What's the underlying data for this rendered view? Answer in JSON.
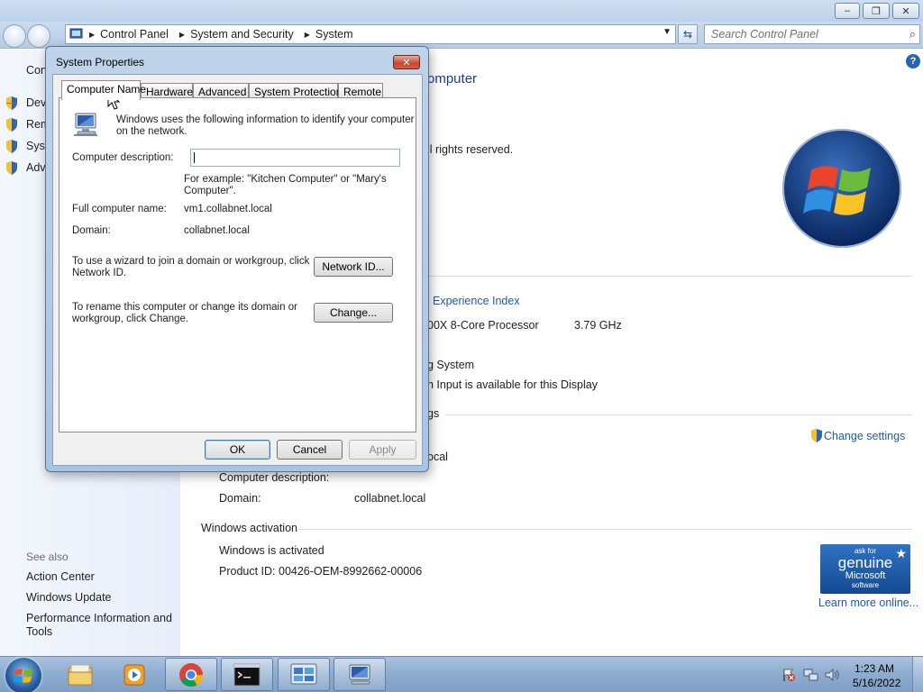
{
  "explorer": {
    "address": [
      "Control Panel",
      "System and Security",
      "System"
    ],
    "search_placeholder": "Search Control Panel"
  },
  "left_pane": {
    "home_label": "Con",
    "items": [
      "Devi",
      "Rem",
      "Syst",
      "Adv"
    ],
    "see_also_label": "See also",
    "see_also": [
      "Action Center",
      "Windows Update",
      "Performance Information and",
      "Tools"
    ]
  },
  "main": {
    "header": "omputer",
    "copyright": "ll rights reserved.",
    "experience_index_link": "Experience Index",
    "processor": "00X 8-Core Processor",
    "processor_speed": "3.79 GHz",
    "system_type": "g System",
    "pen_touch": "h Input is available for this Display",
    "settings_section": "gs",
    "change_settings": "Change settings",
    "domain_partial": "ocal",
    "computer_description_label": "Computer description:",
    "domain_label": "Domain:",
    "domain_value": "collabnet.local",
    "activation_section": "Windows activation",
    "activation_status": "Windows is activated",
    "product_id": "Product ID: 00426-OEM-8992662-00006",
    "genuine_line1": "ask for",
    "genuine_line2": "genuine",
    "genuine_line3": "Microsoft",
    "genuine_line4": "software",
    "learn_more": "Learn more online..."
  },
  "dialog": {
    "title": "System Properties",
    "tabs": [
      "Computer Name",
      "Hardware",
      "Advanced",
      "System Protection",
      "Remote"
    ],
    "intro_line1": "Windows uses the following information to identify your computer",
    "intro_line2": "on the network.",
    "desc_label": "Computer description:",
    "desc_value": "",
    "example_line1": "For example: \"Kitchen Computer\" or \"Mary's",
    "example_line2": "Computer\".",
    "full_name_label": "Full computer name:",
    "full_name_value": "vm1.collabnet.local",
    "domain_label": "Domain:",
    "domain_value": "collabnet.local",
    "wizard_line1": "To use a wizard to join a domain or workgroup, click",
    "wizard_line2": "Network ID.",
    "network_id_button": "Network ID...",
    "rename_line1": "To rename this computer or change its domain or",
    "rename_line2": "workgroup, click Change.",
    "change_button": "Change...",
    "ok_button": "OK",
    "cancel_button": "Cancel",
    "apply_button": "Apply"
  },
  "taskbar": {
    "time": "1:23 AM",
    "date": "5/16/2022"
  }
}
